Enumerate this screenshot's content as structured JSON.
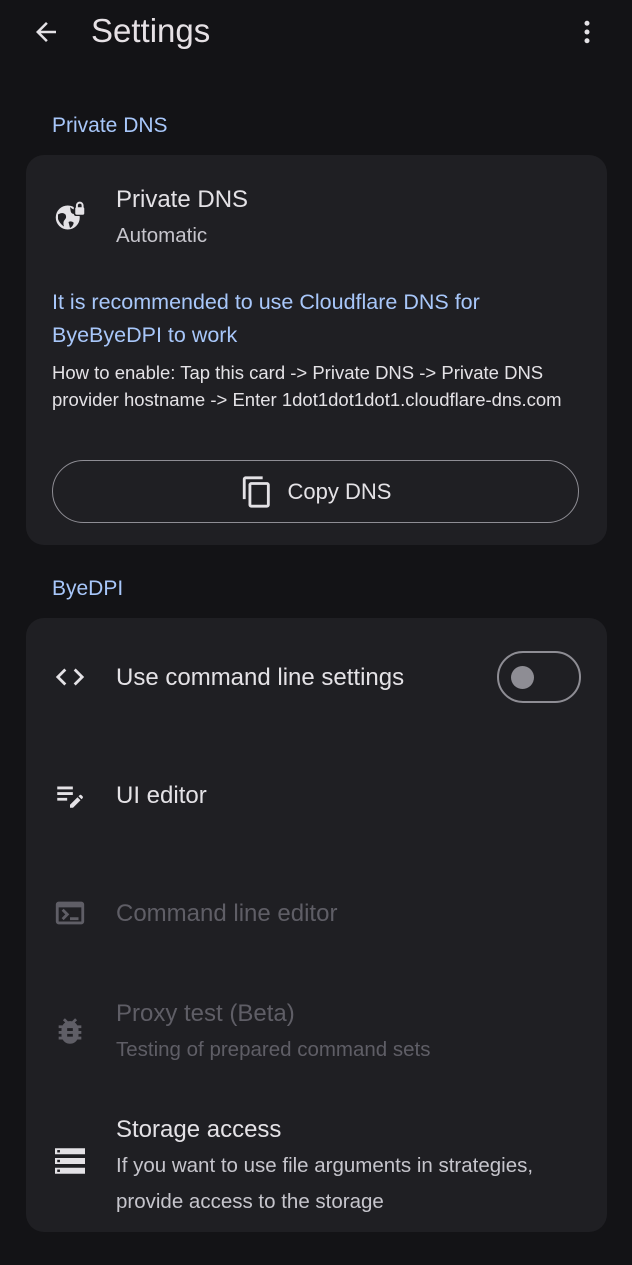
{
  "app_bar": {
    "title": "Settings",
    "back_icon": "arrow-back-icon",
    "menu_icon": "more-vert-icon"
  },
  "private_dns_section": {
    "header": "Private DNS",
    "card": {
      "title": "Private DNS",
      "status": "Automatic",
      "recommendation": "It is recommended to use Cloudflare DNS for ByeByeDPI to work",
      "instructions": "How to enable: Tap this card -> Private DNS -> Private DNS provider hostname -> Enter 1dot1dot1dot1.cloudflare-dns.com",
      "copy_button_label": "Copy DNS",
      "icon": "globe-lock-icon"
    }
  },
  "byedpi_section": {
    "header": "ByeDPI",
    "items": [
      {
        "title": "Use command line settings",
        "icon": "code-icon",
        "toggle_on": false,
        "enabled": true
      },
      {
        "title": "UI editor",
        "icon": "edit-note-icon",
        "enabled": true
      },
      {
        "title": "Command line editor",
        "icon": "terminal-icon",
        "enabled": false
      },
      {
        "title": "Proxy test (Beta)",
        "subtitle": "Testing of prepared command sets",
        "icon": "bug-icon",
        "enabled": false
      },
      {
        "title": "Storage access",
        "subtitle": "If you want to use file arguments in strategies, provide access to the storage",
        "icon": "storage-icon",
        "enabled": true
      }
    ]
  },
  "colors": {
    "background": "#131316",
    "card": "#1f1f23",
    "accent": "#a8c7fa",
    "text_primary": "#e4e2e6",
    "text_disabled": "#5f5e66"
  }
}
